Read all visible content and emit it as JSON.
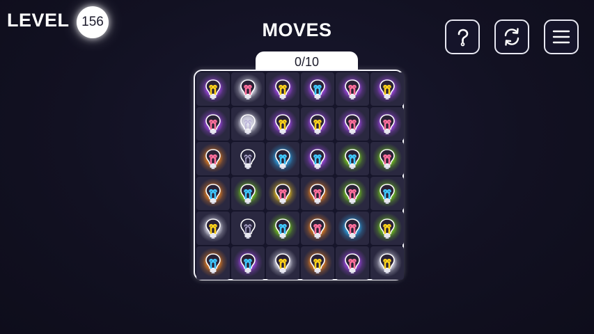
{
  "header": {
    "level_label": "LEVEL",
    "level_number": "156",
    "moves_title": "MOVES",
    "moves_counter": "0/10"
  },
  "buttons": [
    {
      "name": "help-button",
      "icon": "question-icon"
    },
    {
      "name": "restart-button",
      "icon": "refresh-icon"
    },
    {
      "name": "menu-button",
      "icon": "hamburger-menu-icon"
    }
  ],
  "colors": {
    "purple": "#b34cff",
    "white": "#f2f2ff",
    "orange": "#ff8a1c",
    "green": "#7ddc1a",
    "yellow": "#ffd21a",
    "blue": "#2fb6ff",
    "pink": "#ff6f9c",
    "dark": "#4a3a4a",
    "cyan": "#3fc8ff",
    "filament_yellow": "#ffe24a"
  },
  "board": {
    "rows": 6,
    "cols": 6,
    "cells": [
      [
        {
          "glow": "purple",
          "bulb": "yellow"
        },
        {
          "glow": "white",
          "bulb": "pink"
        },
        {
          "glow": "purple",
          "bulb": "yellow"
        },
        {
          "glow": "purple",
          "bulb": "cyan"
        },
        {
          "glow": "purple",
          "bulb": "pink"
        },
        {
          "glow": "purple",
          "bulb": "yellow"
        }
      ],
      [
        {
          "glow": "purple",
          "bulb": "pink"
        },
        {
          "glow": "white",
          "bulb": "dark"
        },
        {
          "glow": "purple",
          "bulb": "yellow"
        },
        {
          "glow": "purple",
          "bulb": "yellow"
        },
        {
          "glow": "purple",
          "bulb": "pink"
        },
        {
          "glow": "purple",
          "bulb": "pink"
        }
      ],
      [
        {
          "glow": "orange",
          "bulb": "pink"
        },
        {
          "glow": "none",
          "bulb": "dark"
        },
        {
          "glow": "blue",
          "bulb": "cyan"
        },
        {
          "glow": "purple",
          "bulb": "cyan"
        },
        {
          "glow": "green",
          "bulb": "cyan"
        },
        {
          "glow": "green",
          "bulb": "pink"
        }
      ],
      [
        {
          "glow": "orange",
          "bulb": "cyan"
        },
        {
          "glow": "green",
          "bulb": "cyan"
        },
        {
          "glow": "yellow",
          "bulb": "pink"
        },
        {
          "glow": "orange",
          "bulb": "pink"
        },
        {
          "glow": "green",
          "bulb": "pink"
        },
        {
          "glow": "green",
          "bulb": "cyan"
        }
      ],
      [
        {
          "glow": "white",
          "bulb": "yellow"
        },
        {
          "glow": "none",
          "bulb": "dark"
        },
        {
          "glow": "green",
          "bulb": "cyan"
        },
        {
          "glow": "orange",
          "bulb": "pink"
        },
        {
          "glow": "blue",
          "bulb": "pink"
        },
        {
          "glow": "green",
          "bulb": "yellow"
        }
      ],
      [
        {
          "glow": "orange",
          "bulb": "cyan"
        },
        {
          "glow": "purple",
          "bulb": "cyan"
        },
        {
          "glow": "white",
          "bulb": "yellow"
        },
        {
          "glow": "orange",
          "bulb": "yellow"
        },
        {
          "glow": "purple",
          "bulb": "pink"
        },
        {
          "glow": "white",
          "bulb": "yellow"
        }
      ]
    ]
  }
}
